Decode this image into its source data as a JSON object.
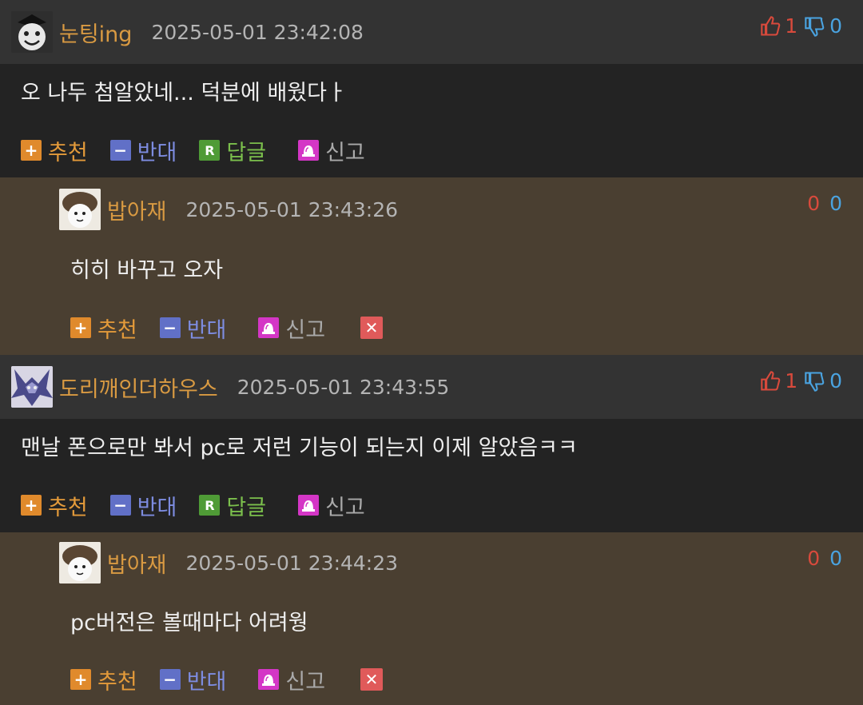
{
  "actions": {
    "recommend": "추천",
    "oppose": "반대",
    "reply": "답글",
    "report": "신고"
  },
  "comments": [
    {
      "nick": "눈팅ing",
      "date": "2025-05-01 23:42:08",
      "up": "1",
      "down": "0",
      "text": "오 나두 첨알았네... 덕분에 배웠다ㅏ"
    },
    {
      "nick": "밥아재",
      "date": "2025-05-01 23:43:26",
      "up": "0",
      "down": "0",
      "text": "히히 바꾸고 오자"
    },
    {
      "nick": "도리깨인더하우스",
      "date": "2025-05-01 23:43:55",
      "up": "1",
      "down": "0",
      "text": "맨날 폰으로만 봐서 pc로 저런 기능이 되는지 이제 알았음ㅋㅋ"
    },
    {
      "nick": "밥아재",
      "date": "2025-05-01 23:44:23",
      "up": "0",
      "down": "0",
      "text": "pc버전은 볼때마다 어려웡"
    }
  ]
}
